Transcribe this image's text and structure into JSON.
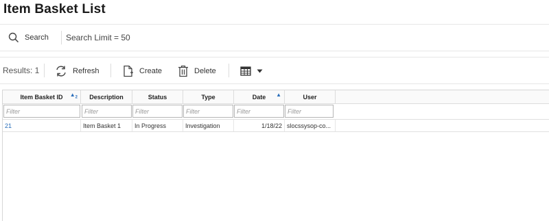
{
  "page": {
    "title": "Item Basket List"
  },
  "search": {
    "label": "Search",
    "limit_text": "Search Limit = 50"
  },
  "toolbar": {
    "results_text": "Results: 1",
    "refresh_label": "Refresh",
    "create_label": "Create",
    "delete_label": "Delete",
    "icons": [
      "refresh-icon",
      "create-icon",
      "delete-icon",
      "table-view-icon",
      "chevron-down-icon"
    ]
  },
  "grid": {
    "columns": [
      "Item Basket ID",
      "Description",
      "Status",
      "Type",
      "Date",
      "User"
    ],
    "filter_placeholder": "Filter",
    "sort_indicators": {
      "item_basket_id": "2",
      "date": ""
    },
    "rows": [
      {
        "item_basket_id": "21",
        "description": "Item Basket 1",
        "status": "In Progress",
        "type": "Investigation",
        "date": "1/18/22",
        "user": "slocssysop-co..."
      }
    ]
  },
  "colors": {
    "link": "#2a6ebb",
    "sort_indicator": "#2a6ebb",
    "border": "#d6d6d6"
  }
}
